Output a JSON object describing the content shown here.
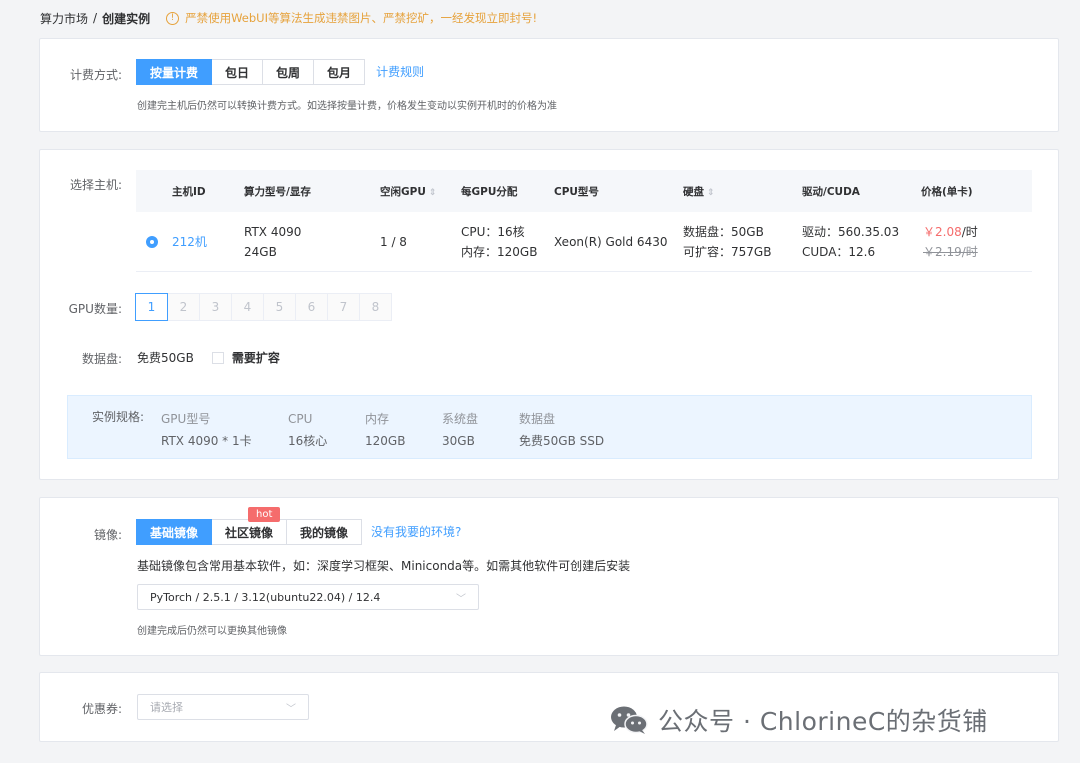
{
  "breadcrumb": {
    "root": "算力市场",
    "sep": "/",
    "current": "创建实例"
  },
  "warning": {
    "icon": "exclamation-circle-icon",
    "text": "严禁使用WebUI等算法生成违禁图片、严禁挖矿，一经发现立即封号!"
  },
  "billing": {
    "label": "计费方式:",
    "options": [
      "按量计费",
      "包日",
      "包周",
      "包月"
    ],
    "selected": "按量计费",
    "rules_link": "计费规则",
    "hint": "创建完主机后仍然可以转换计费方式。如选择按量计费，价格发生变动以实例开机时的价格为准"
  },
  "host": {
    "label": "选择主机:",
    "columns": [
      "主机ID",
      "算力型号/显存",
      "空闲GPU",
      "每GPU分配",
      "CPU型号",
      "硬盘",
      "驱动/CUDA",
      "价格(单卡)"
    ],
    "row": {
      "id": "212机",
      "model_line1": "RTX 4090",
      "model_line2": "24GB",
      "free_gpu": "1 / 8",
      "alloc_line1": "CPU：16核",
      "alloc_line2": "内存：120GB",
      "cpu": "Xeon(R) Gold 6430",
      "disk_line1": "数据盘：50GB",
      "disk_line2": "可扩容：757GB",
      "driver_line1": "驱动：560.35.03",
      "driver_line2": "CUDA：12.6",
      "price_now": "￥2.08",
      "price_unit": "/时",
      "price_old": "￥2.19/时"
    }
  },
  "gpu_count": {
    "label": "GPU数量:",
    "options": [
      "1",
      "2",
      "3",
      "4",
      "5",
      "6",
      "7",
      "8"
    ],
    "selected": "1"
  },
  "data_disk": {
    "label": "数据盘:",
    "free": "免费50GB",
    "expand_label": "需要扩容"
  },
  "spec": {
    "label": "实例规格:",
    "items": [
      {
        "k": "GPU型号",
        "v": "RTX 4090 * 1卡"
      },
      {
        "k": "CPU",
        "v": "16核心"
      },
      {
        "k": "内存",
        "v": "120GB"
      },
      {
        "k": "系统盘",
        "v": "30GB"
      },
      {
        "k": "数据盘",
        "v": "免费50GB SSD"
      }
    ]
  },
  "image": {
    "label": "镜像:",
    "tabs": [
      "基础镜像",
      "社区镜像",
      "我的镜像"
    ],
    "selected": "基础镜像",
    "hot_badge": "hot",
    "missing_link": "没有我要的环境?",
    "desc": "基础镜像包含常用基本软件，如：深度学习框架、Miniconda等。如需其他软件可创建后安装",
    "selected_image": "PyTorch / 2.5.1 / 3.12(ubuntu22.04) / 12.4",
    "hint": "创建完成后仍然可以更换其他镜像"
  },
  "coupon": {
    "label": "优惠券:",
    "placeholder": "请选择"
  },
  "watermark": {
    "icon": "wechat-icon",
    "text": "公众号 · ChlorineC的杂货铺"
  },
  "colors": {
    "primary": "#409eff",
    "warning": "#e6a23c",
    "danger": "#f56c6c"
  }
}
